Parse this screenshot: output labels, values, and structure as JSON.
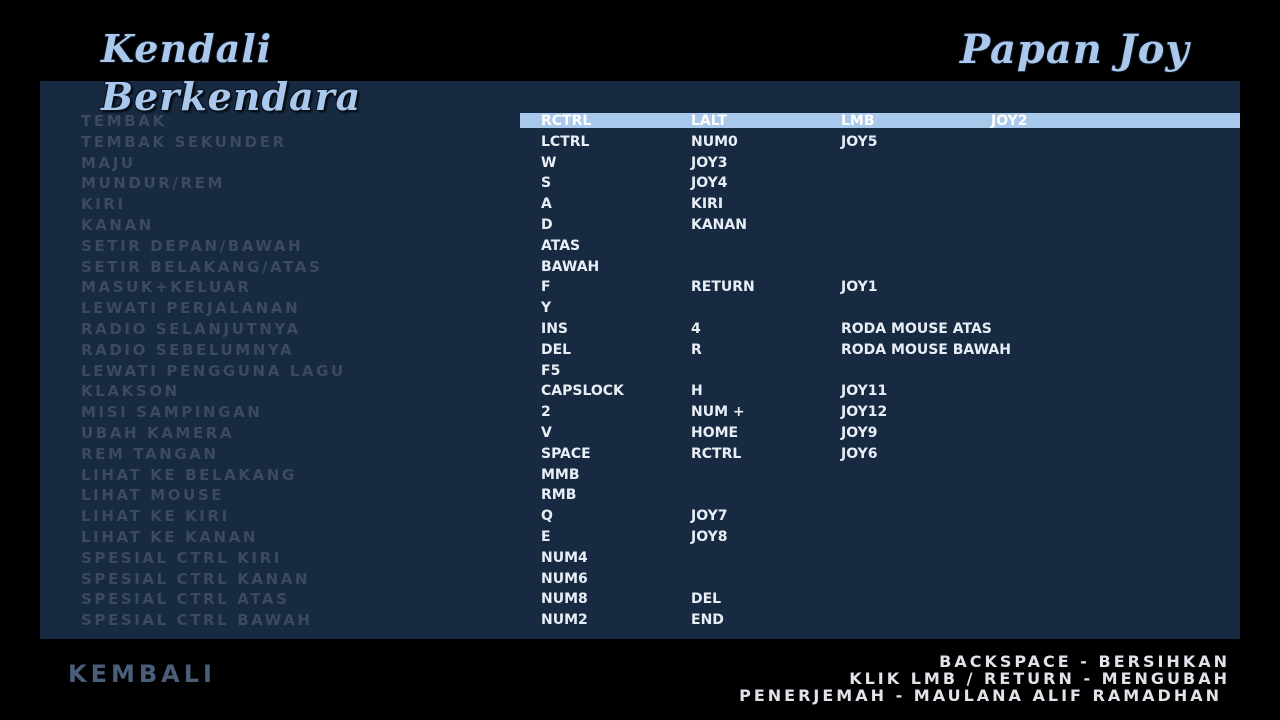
{
  "header": {
    "title_line_1": "Kendali",
    "title_line_2": "Berkendara",
    "joypad_title": "Papan Joy"
  },
  "bindings": [
    {
      "action": "TEMBAK",
      "keys": [
        "RCTRL",
        "LALT",
        "LMB",
        "JOY2"
      ],
      "selected": true
    },
    {
      "action": "TEMBAK SEKUNDER",
      "keys": [
        "LCTRL",
        "NUM0",
        "JOY5",
        ""
      ]
    },
    {
      "action": "MAJU",
      "keys": [
        "W",
        "JOY3",
        "",
        ""
      ]
    },
    {
      "action": "MUNDUR/REM",
      "keys": [
        "S",
        "JOY4",
        "",
        ""
      ]
    },
    {
      "action": "KIRI",
      "keys": [
        "A",
        "KIRI",
        "",
        ""
      ]
    },
    {
      "action": "KANAN",
      "keys": [
        "D",
        "KANAN",
        "",
        ""
      ]
    },
    {
      "action": "SETIR DEPAN/BAWAH",
      "keys": [
        "ATAS",
        "",
        "",
        ""
      ]
    },
    {
      "action": "SETIR BELAKANG/ATAS",
      "keys": [
        "BAWAH",
        "",
        "",
        ""
      ]
    },
    {
      "action": "MASUK+KELUAR",
      "keys": [
        "F",
        "RETURN",
        "JOY1",
        ""
      ]
    },
    {
      "action": "LEWATI PERJALANAN",
      "keys": [
        "Y",
        "",
        "",
        ""
      ]
    },
    {
      "action": "RADIO SELANJUTNYA",
      "keys": [
        "INS",
        "4",
        "RODA MOUSE ATAS",
        ""
      ]
    },
    {
      "action": "RADIO SEBELUMNYA",
      "keys": [
        "DEL",
        "R",
        "RODA MOUSE BAWAH",
        ""
      ]
    },
    {
      "action": "LEWATI PENGGUNA LAGU",
      "keys": [
        "F5",
        "",
        "",
        ""
      ]
    },
    {
      "action": "KLAKSON",
      "keys": [
        "CAPSLOCK",
        "H",
        "JOY11",
        ""
      ]
    },
    {
      "action": "MISI SAMPINGAN",
      "keys": [
        "2",
        "NUM +",
        "JOY12",
        ""
      ]
    },
    {
      "action": "UBAH KAMERA",
      "keys": [
        "V",
        "HOME",
        "JOY9",
        ""
      ]
    },
    {
      "action": "REM TANGAN",
      "keys": [
        "SPACE",
        "RCTRL",
        "JOY6",
        ""
      ]
    },
    {
      "action": "LIHAT KE BELAKANG",
      "keys": [
        "MMB",
        "",
        "",
        ""
      ]
    },
    {
      "action": "LIHAT MOUSE",
      "keys": [
        "RMB",
        "",
        "",
        ""
      ]
    },
    {
      "action": "LIHAT KE KIRI",
      "keys": [
        "Q",
        "JOY7",
        "",
        ""
      ]
    },
    {
      "action": "LIHAT KE KANAN",
      "keys": [
        "E",
        "JOY8",
        "",
        ""
      ]
    },
    {
      "action": "SPESIAL CTRL KIRI",
      "keys": [
        "NUM4",
        "",
        "",
        ""
      ]
    },
    {
      "action": "SPESIAL CTRL KANAN",
      "keys": [
        "NUM6",
        "",
        "",
        ""
      ]
    },
    {
      "action": "SPESIAL CTRL ATAS",
      "keys": [
        "NUM8",
        "DEL",
        "",
        ""
      ]
    },
    {
      "action": "SPESIAL CTRL BAWAH",
      "keys": [
        "NUM2",
        "END",
        "",
        ""
      ]
    }
  ],
  "footer": {
    "back_label": "KEMBALI",
    "hint_clear": "BACKSPACE - BERSIHKAN",
    "hint_change": "KLIK LMB / RETURN - MENGUBAH",
    "credit": "PENERJEMAH - MAULANA ALIF RAMADHAN"
  },
  "colors": {
    "background": "#000000",
    "panel": "#172a41",
    "selection": "#a9c9ec",
    "action_text": "#3b4a5c",
    "key_text": "#e8eef5",
    "title": "#a9c8ec"
  }
}
